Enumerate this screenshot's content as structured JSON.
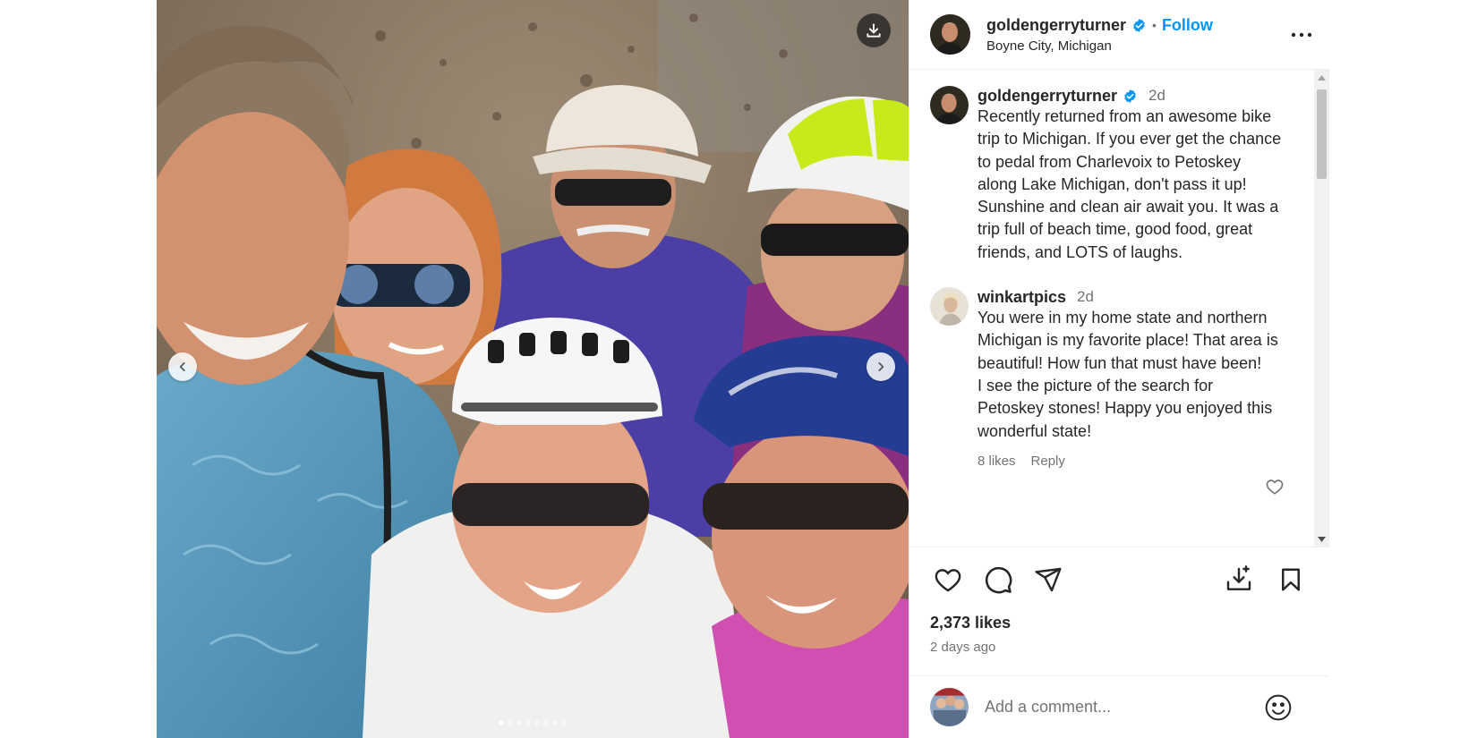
{
  "header": {
    "username": "goldengerryturner",
    "separator": "•",
    "follow_label": "Follow",
    "location": "Boyne City, Michigan"
  },
  "icons": {
    "verified": "verified-badge-icon",
    "more": "more-options-icon",
    "download": "download-icon",
    "prev": "chevron-left-icon",
    "next": "chevron-right-icon",
    "like": "heart-icon",
    "comment": "comment-bubble-icon",
    "share": "paper-plane-icon",
    "save_to": "download-to-collection-icon",
    "bookmark": "bookmark-icon",
    "emoji": "smiley-icon"
  },
  "caption": {
    "username": "goldengerryturner",
    "time": "2d",
    "text": "Recently returned from an awesome bike trip to Michigan. If you ever get the chance to pedal from Charlevoix to Petoskey along Lake Michigan, don't pass it up! Sunshine and clean air await you. It was a trip full of beach time, good food, great friends, and LOTS of laughs."
  },
  "comments": [
    {
      "username": "winkartpics",
      "time": "2d",
      "text": "You were in my home state and northern Michigan is my favorite place! That area is beautiful! How fun that must have been!\nI see the picture of the search for Petoskey stones! Happy you enjoyed this wonderful state!",
      "likes": "8 likes",
      "reply_label": "Reply"
    }
  ],
  "stats": {
    "likes": "2,373 likes",
    "posted": "2 days ago"
  },
  "add_comment": {
    "placeholder": "Add a comment..."
  },
  "carousel": {
    "slide_count": 8,
    "active_index": 0
  },
  "colors": {
    "link_blue": "#0095f6",
    "verified_blue": "#0095f6",
    "text": "#262626",
    "muted": "#737373"
  }
}
